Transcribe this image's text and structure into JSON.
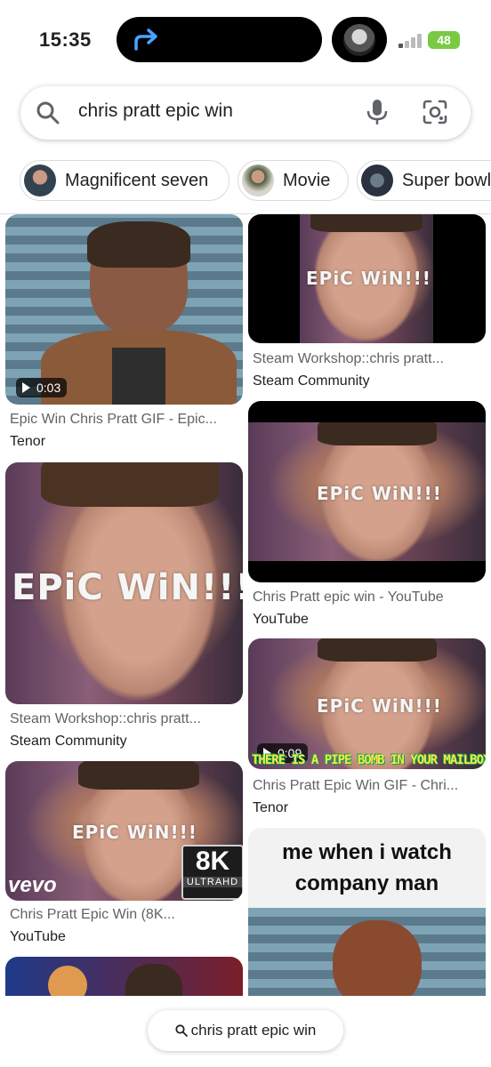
{
  "status": {
    "time": "15:35",
    "battery": "48"
  },
  "search": {
    "query": "chris pratt epic win"
  },
  "chips": [
    {
      "label": "Magnificent seven"
    },
    {
      "label": "Movie"
    },
    {
      "label": "Super bowl"
    }
  ],
  "results": [
    {
      "title": "Epic Win Chris Pratt GIF - Epic...",
      "source": "Tenor",
      "duration": "0:03"
    },
    {
      "title": "Steam Workshop::chris pratt...",
      "source": "Steam Community",
      "overlay": "EPiC WiN!!!"
    },
    {
      "title": "Chris Pratt Epic Win (8K...",
      "source": "YouTube",
      "overlay": "EPiC WiN!!!",
      "badge": "8K",
      "badge_sub": "ULTRAHD",
      "brand": "vevo"
    },
    {
      "title": "Steam Workshop::chris pratt...",
      "source": "Steam Community",
      "overlay": "EPiC WiN!!!"
    },
    {
      "title": "Chris Pratt epic win - YouTube",
      "source": "YouTube",
      "overlay": "EPiC WiN!!!"
    },
    {
      "title": "Chris Pratt Epic Win GIF - Chri...",
      "source": "Tenor",
      "overlay": "EPiC WiN!!!",
      "duration": "0:09",
      "caption": "THERE IS A PIPE BOMB IN YOUR MAILBOX"
    },
    {
      "caption_top": "me when i watch company man"
    }
  ],
  "bottom_pill": {
    "query": "chris pratt epic win"
  }
}
